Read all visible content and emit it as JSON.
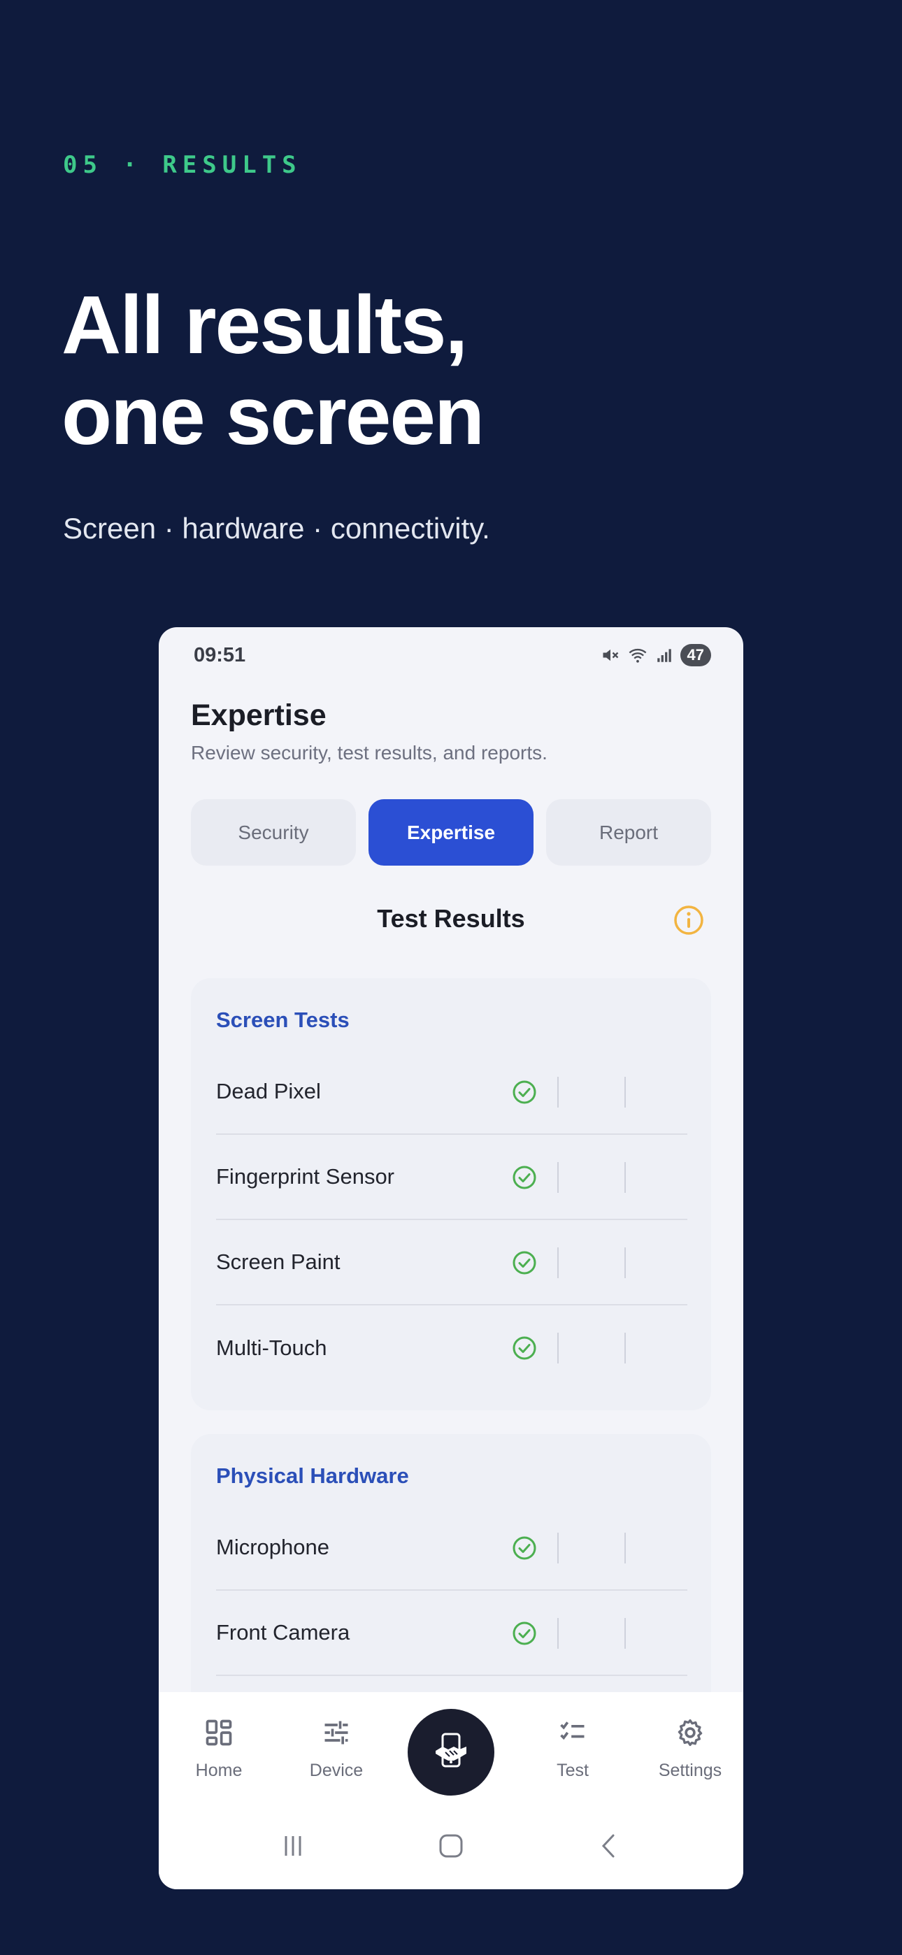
{
  "hero": {
    "eyebrow": "05 · RESULTS",
    "headline_line1": "All results,",
    "headline_line2": "one screen",
    "subline": "Screen · hardware · connectivity."
  },
  "status": {
    "time": "09:51",
    "battery": "47",
    "icons": [
      "mute-icon",
      "wifi-icon",
      "signal-icon",
      "battery-icon"
    ]
  },
  "app": {
    "title": "Expertise",
    "subtitle": "Review security, test results, and reports.",
    "tabs": [
      {
        "label": "Security",
        "active": false
      },
      {
        "label": "Expertise",
        "active": true
      },
      {
        "label": "Report",
        "active": false
      }
    ],
    "section_title": "Test Results"
  },
  "cards": [
    {
      "title": "Screen Tests",
      "rows": [
        {
          "label": "Dead Pixel",
          "status": "passed"
        },
        {
          "label": "Fingerprint Sensor",
          "status": "passed"
        },
        {
          "label": "Screen Paint",
          "status": "passed"
        },
        {
          "label": "Multi-Touch",
          "status": "passed"
        }
      ]
    },
    {
      "title": "Physical Hardware",
      "rows": [
        {
          "label": "Microphone",
          "status": "passed"
        },
        {
          "label": "Front Camera",
          "status": "passed"
        }
      ]
    }
  ],
  "nav": {
    "items": [
      {
        "label": "Home",
        "icon": "dashboard-icon"
      },
      {
        "label": "Device",
        "icon": "sliders-icon"
      },
      {
        "label": "",
        "icon": "phone-handshake-icon"
      },
      {
        "label": "Test",
        "icon": "checklist-icon"
      },
      {
        "label": "Settings",
        "icon": "gear-icon"
      }
    ]
  },
  "colors": {
    "background": "#0f1b3d",
    "accent": "#2b4fd4",
    "eyebrow": "#3ec98a",
    "success": "#4caf50",
    "info": "#f2b441"
  }
}
